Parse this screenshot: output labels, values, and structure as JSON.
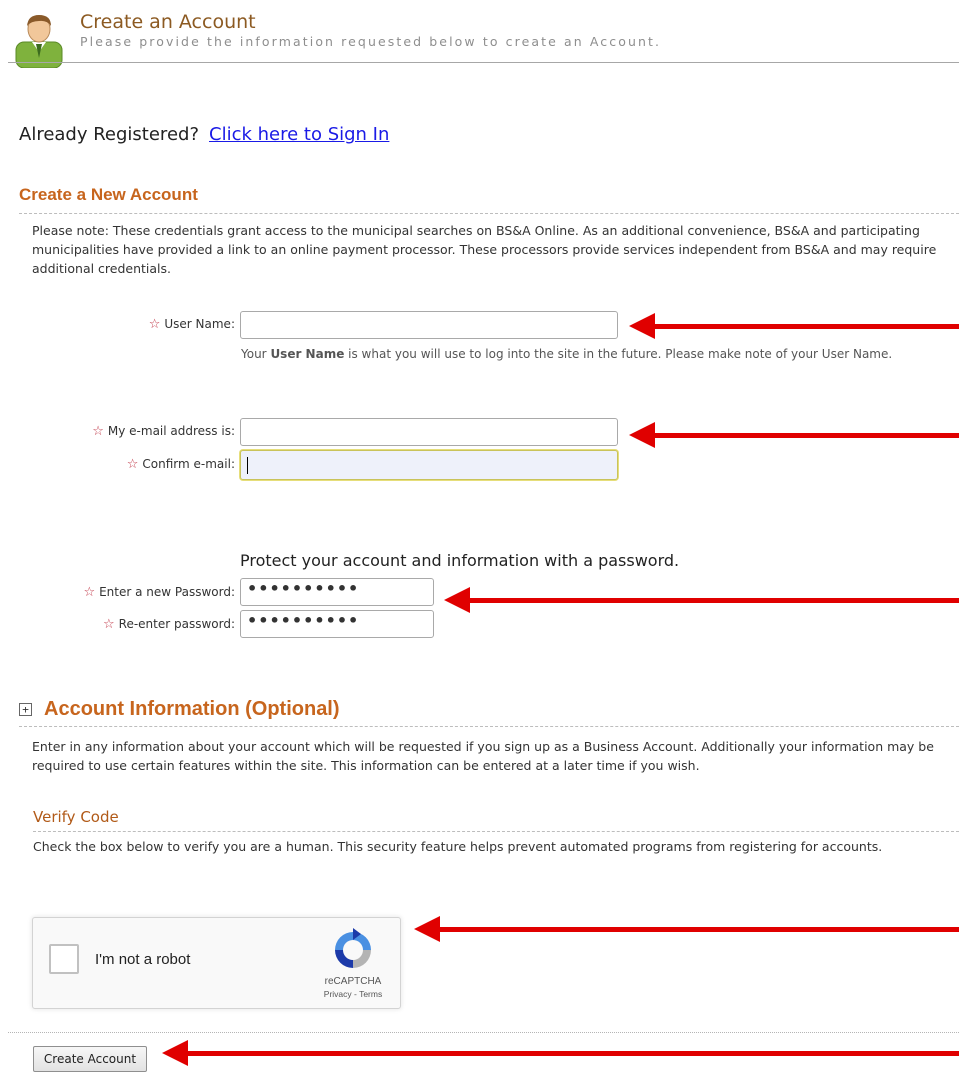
{
  "header": {
    "title": "Create an Account",
    "subtitle": "Please provide the information requested below to create an Account."
  },
  "already": {
    "text": "Already Registered?",
    "link": "Click here to Sign In"
  },
  "new_account": {
    "title": "Create a New Account",
    "note": "Please note: These credentials grant access to the municipal searches on BS&A Online. As an additional convenience, BS&A and participating municipalities have provided a link to an online payment processor. These processors provide services independent from BS&A and may require additional credentials."
  },
  "form": {
    "username_label": "User Name:",
    "username_value": "",
    "username_hint_prefix": "Your ",
    "username_hint_bold": "User Name",
    "username_hint_suffix": " is what you will use to log into the site in the future. Please make note of your User Name.",
    "email_label": "My e-mail address is:",
    "email_value": "",
    "confirm_email_label": "Confirm e-mail:",
    "confirm_email_value": "",
    "password_heading": "Protect your account and information with a password.",
    "password_label": "Enter a new Password:",
    "password_value": "••••••••••",
    "reenter_label": "Re-enter password:",
    "reenter_value": "••••••••••",
    "required_icon": "star-icon"
  },
  "account_info": {
    "expand_icon": "plus-box-icon",
    "expand_symbol": "+",
    "title": "Account Information (Optional)",
    "text": "Enter in any information about your account which will be requested if you sign up as a Business Account.  Additionally your information may be required to use certain features within the site. This information can be entered at a later time if you wish."
  },
  "verify": {
    "title": "Verify Code",
    "text": "Check the box below to verify you are a human. This security feature helps prevent automated programs from registering for accounts."
  },
  "captcha": {
    "label": "I'm not a robot",
    "brand": "reCAPTCHA",
    "links": "Privacy - Terms",
    "checked": false
  },
  "submit_label": "Create Account",
  "colors": {
    "section_title": "#c7651d",
    "header_title": "#8c5a22",
    "link": "#1a1ae6",
    "required_star": "#c23b4b",
    "annotation_arrow": "#e00000"
  }
}
